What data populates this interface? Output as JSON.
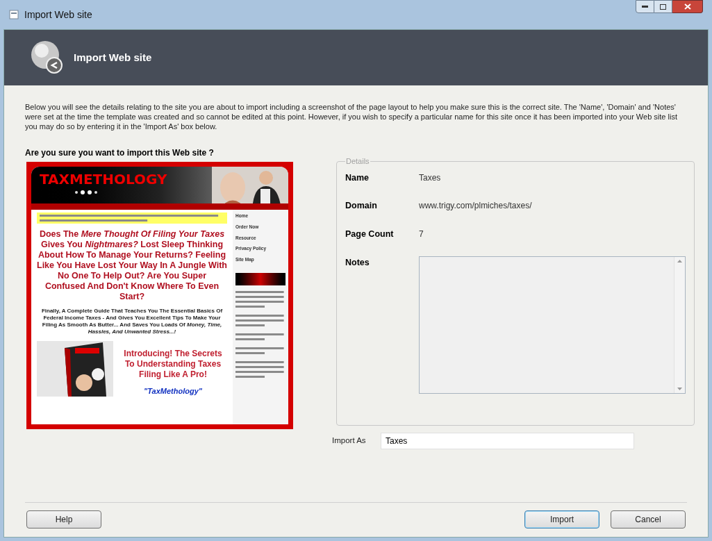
{
  "window": {
    "title": "Import Web site"
  },
  "header": {
    "title": "Import Web site"
  },
  "intro": "Below you will see the details relating to the site you are about to import including a screenshot of the page layout to help you make sure this is the correct site. The 'Name', 'Domain' and 'Notes' were set at the time the template was created and so cannot be edited at this point. However, if you wish to specify a particular name for this site once it has been imported into your Web site list you may do so by entering it in the 'Import As' box below.",
  "question": "Are you sure you want to import this Web site ?",
  "preview": {
    "logo": "TAXMETHOLOGY",
    "nav": [
      "Home",
      "Order Now",
      "Resource",
      "Privacy Policy",
      "Site Map"
    ],
    "headline": "Does The *Mere Thought Of Filing Your Taxes* Gives You *Nightmares?* Lost Sleep Thinking About How To Manage Your Returns? Feeling Like You Have Lost Your Way In A Jungle With No One To Help Out? Are You Super Confused And Don't Know Where To Even Start?",
    "guide": "Finally, A Complete Guide That Teaches You **The Essential Basics Of Federal Income Taxes** - And Gives You Excellent Tips To Make Your Filing As Smooth As Butter... And Saves You Loads Of *Money, Time, Hassles, And Unwanted Stress...!*",
    "promo": "Introducing! The Secrets To Understanding Taxes Filing Like A Pro!",
    "product": "\"TaxMethology\""
  },
  "details": {
    "legend": "Details",
    "fields": [
      {
        "kind": "text",
        "label": "Name",
        "value": "Taxes"
      },
      {
        "kind": "text",
        "label": "Domain",
        "value": "www.trigy.com/plmiches/taxes/"
      },
      {
        "kind": "text",
        "label": "Page Count",
        "value": "7"
      },
      {
        "kind": "textarea",
        "label": "Notes"
      }
    ]
  },
  "import_as": {
    "label": "Import As",
    "value": "Taxes"
  },
  "buttons": [
    {
      "label": "Help",
      "default": false
    },
    {
      "label": "Import",
      "default": true
    },
    {
      "label": "Cancel",
      "default": false
    }
  ]
}
